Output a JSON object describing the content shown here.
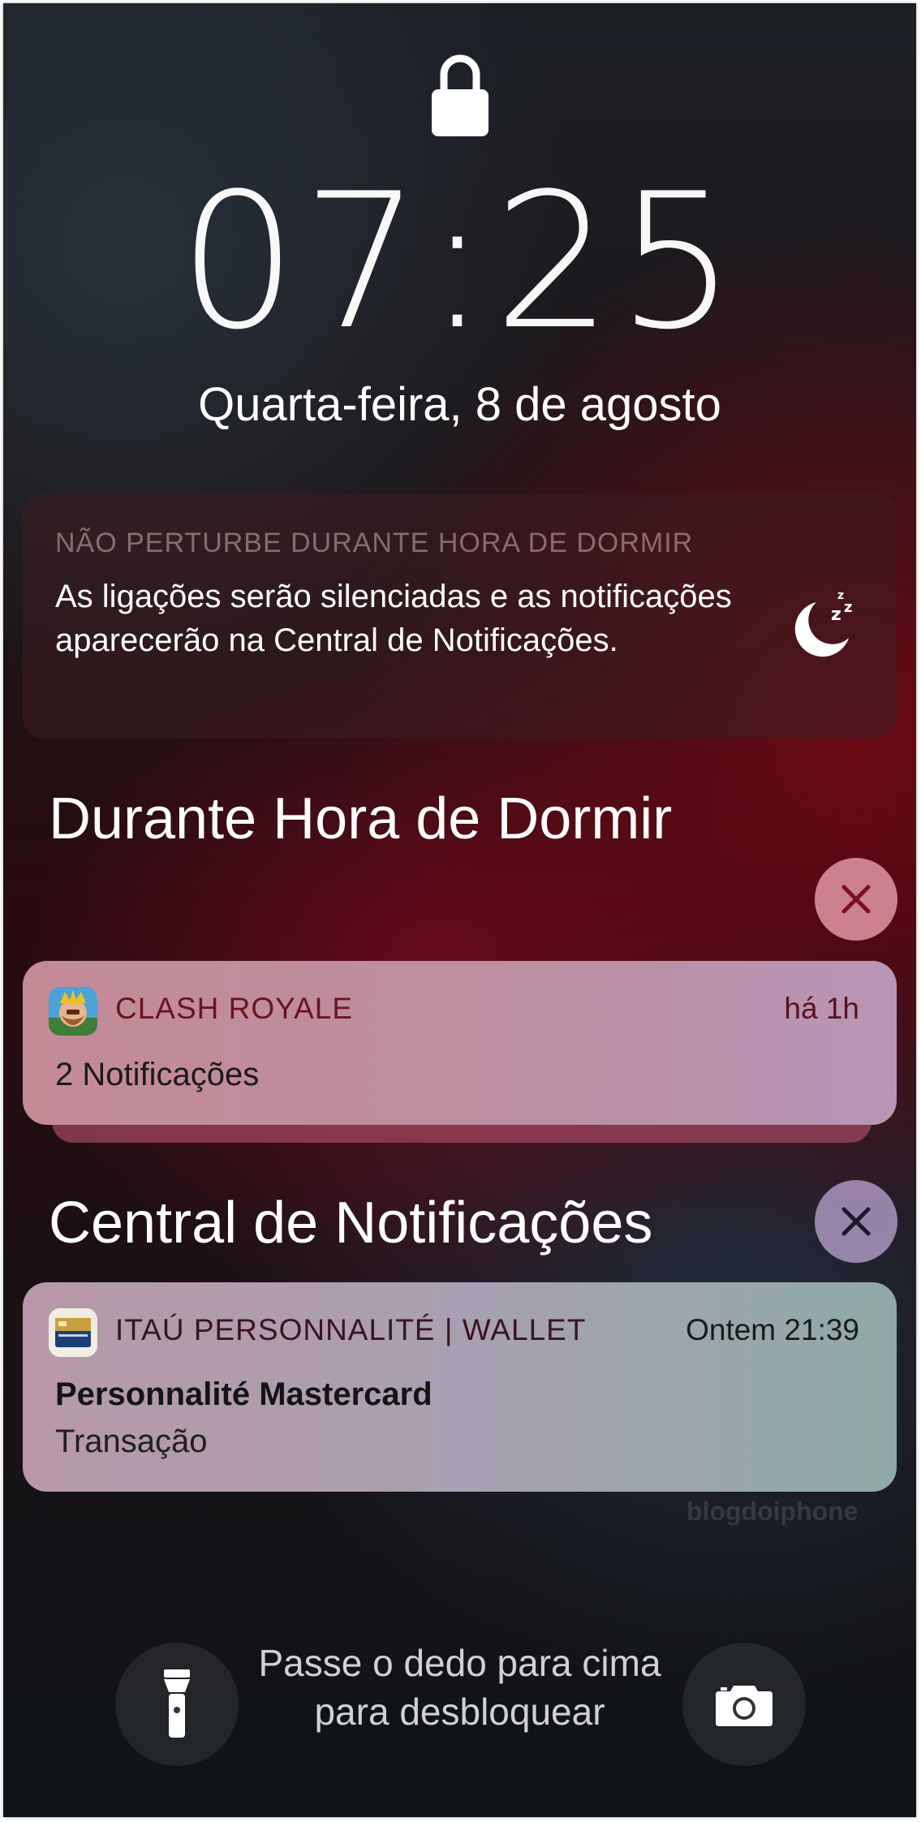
{
  "lock_screen": {
    "time": "07:25",
    "date": "Quarta-feira, 8 de agosto",
    "lock_icon": "padlock-icon"
  },
  "dnd_banner": {
    "title": "NÃO PERTURBE DURANTE HORA DE DORMIR",
    "body": "As ligações serão silenciadas e as notificações aparecerão na Central de Notificações.",
    "icon": "moon-sleep-icon"
  },
  "sections": [
    {
      "title": "Durante Hora de Dormir",
      "clear_icon": "close-icon",
      "notification": {
        "app_name": "CLASH ROYALE",
        "time": "há 1h",
        "text": "2 Notificações",
        "icon": "clash-royale-app-icon"
      }
    },
    {
      "title": "Central de Notificações",
      "clear_icon": "close-icon",
      "notification": {
        "app_name": "ITAÚ PERSONNALITÉ | WALLET",
        "time": "Ontem 21:39",
        "title": "Personnalité Mastercard",
        "text": "Transação",
        "icon": "itau-personnalite-card-icon"
      }
    }
  ],
  "watermark": "blogdoiphone",
  "bottom": {
    "unlock_hint": "Passe o dedo para cima para desbloquear",
    "left_button_icon": "flashlight-icon",
    "right_button_icon": "camera-icon"
  },
  "colors": {
    "banner_background": "#3c1e22",
    "clash_card": "#c08a98",
    "itau_card": "#9aa5ac",
    "app_name_dark_red": "#6a1420"
  }
}
